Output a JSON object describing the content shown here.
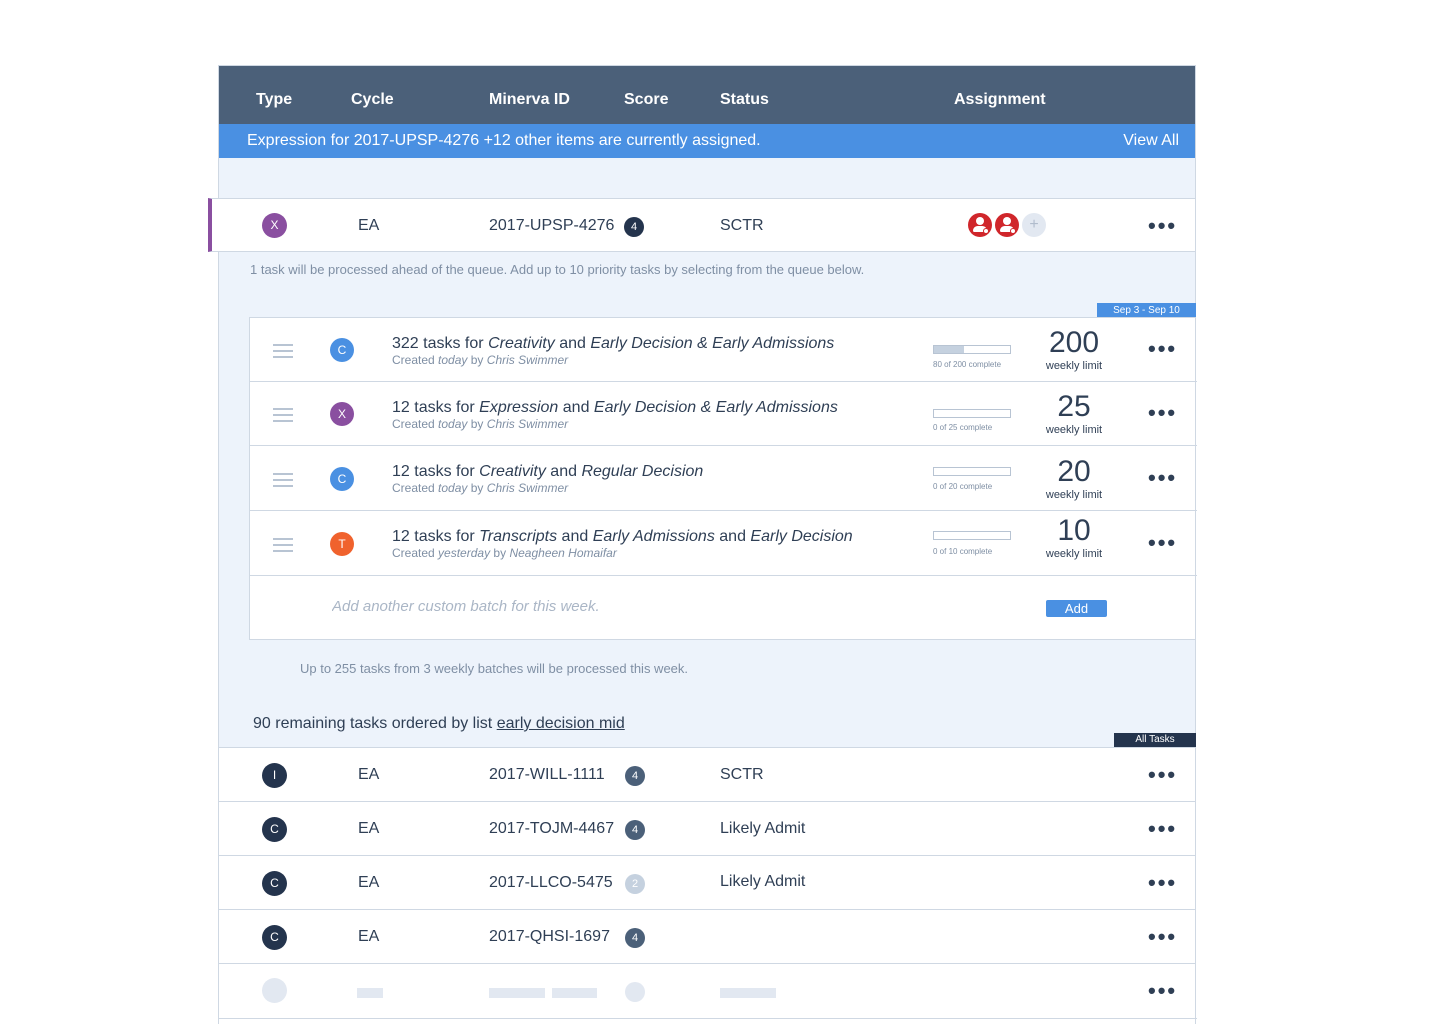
{
  "header": {
    "columns": [
      "Type",
      "Cycle",
      "Minerva ID",
      "Score",
      "Status",
      "Assignment"
    ]
  },
  "banner": {
    "message": "Expression for 2017-UPSP-4276 +12 other items are currently assigned.",
    "view_all": "View All"
  },
  "priority": {
    "type": "X",
    "type_color": "#8a4fa0",
    "cycle": "EA",
    "minerva_id": "2017-UPSP-4276",
    "score": "4",
    "status": "SCTR",
    "add_assignee": "+"
  },
  "priority_note": "1 task will be processed ahead of the queue.  Add up to 10 priority tasks by selecting from the queue below.",
  "week_tag": "Sep 3 - Sep 10",
  "batches": [
    {
      "type": "C",
      "type_color": "#4a90e2",
      "count": "322 tasks for",
      "subject": "Creativity",
      "joiner": "and",
      "plan": "Early Decision & Early Admissions",
      "joiner2": "",
      "plan2": "",
      "created": "Created",
      "when": "today",
      "by": "by",
      "author": "Chris Swimmer",
      "progress": 0.4,
      "progress_label": "80 of 200 complete",
      "limit": "200",
      "limit_label": "weekly limit"
    },
    {
      "type": "X",
      "type_color": "#8a4fa0",
      "count": "12 tasks for",
      "subject": "Expression",
      "joiner": "and",
      "plan": "Early Decision & Early Admissions",
      "joiner2": "",
      "plan2": "",
      "created": "Created",
      "when": "today",
      "by": "by",
      "author": "Chris Swimmer",
      "progress": 0,
      "progress_label": "0 of 25 complete",
      "limit": "25",
      "limit_label": "weekly limit"
    },
    {
      "type": "C",
      "type_color": "#4a90e2",
      "count": "12 tasks for",
      "subject": "Creativity",
      "joiner": "and",
      "plan": "Regular Decision",
      "joiner2": "",
      "plan2": "",
      "created": "Created",
      "when": "today",
      "by": "by",
      "author": "Chris Swimmer",
      "progress": 0,
      "progress_label": "0 of 20 complete",
      "limit": "20",
      "limit_label": "weekly limit"
    },
    {
      "type": "T",
      "type_color": "#f0622d",
      "count": "12 tasks for",
      "subject": "Transcripts",
      "joiner": "and",
      "plan": "Early Admissions",
      "joiner2": "and",
      "plan2": "Early Decision",
      "created": "Created",
      "when": "yesterday",
      "by": "by",
      "author": "Neagheen Homaifar",
      "progress": 0,
      "progress_label": "0 of 10 complete",
      "limit": "10",
      "limit_label": "weekly limit"
    }
  ],
  "add_batch": {
    "placeholder": "Add another custom batch for this week.",
    "button": "Add"
  },
  "weekly_note": "Up to 255 tasks from 3 weekly batches will be processed this week.",
  "remaining": {
    "prefix": "90 remaining tasks ordered by list",
    "list_name": "early decision mid"
  },
  "all_tasks_tag": "All Tasks",
  "queue": [
    {
      "type": "I",
      "cycle": "EA",
      "minerva_id": "2017-WILL-1111",
      "score": "4",
      "score_color": "#4b6079",
      "status": "SCTR"
    },
    {
      "type": "C",
      "cycle": "EA",
      "minerva_id": "2017-TOJM-4467",
      "score": "4",
      "score_color": "#4b6079",
      "status": "Likely Admit"
    },
    {
      "type": "C",
      "cycle": "EA",
      "minerva_id": "2017-LLCO-5475",
      "score": "2",
      "score_color": "#c5d1df",
      "status": "Likely Admit"
    },
    {
      "type": "C",
      "cycle": "EA",
      "minerva_id": "2017-QHSI-1697",
      "score": "4",
      "score_color": "#4b6079",
      "status": ""
    }
  ],
  "colors": {
    "header_bg": "#4b6079",
    "banner_bg": "#4a90e2",
    "type_avatar_dark": "#24344d",
    "assignee_red": "#d0262b"
  }
}
